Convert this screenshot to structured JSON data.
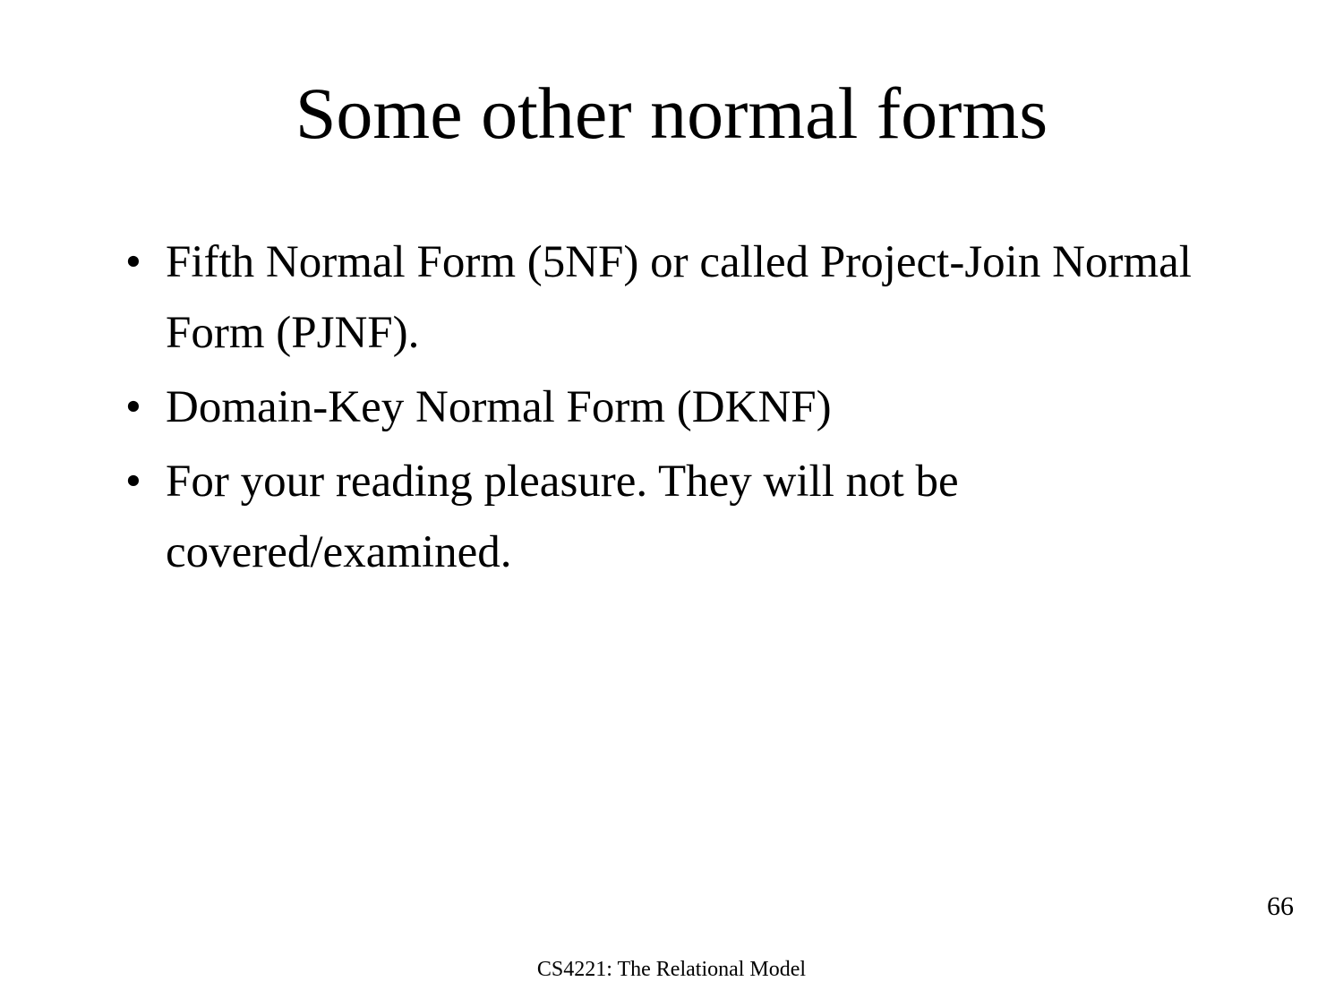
{
  "slide": {
    "title": "Some other normal forms",
    "bullets": [
      "Fifth Normal Form (5NF) or called Project-Join Normal Form (PJNF).",
      "Domain-Key Normal Form (DKNF)",
      "For your reading pleasure. They will not be covered/examined."
    ],
    "footer": "CS4221: The Relational Model",
    "page_number": "66"
  }
}
